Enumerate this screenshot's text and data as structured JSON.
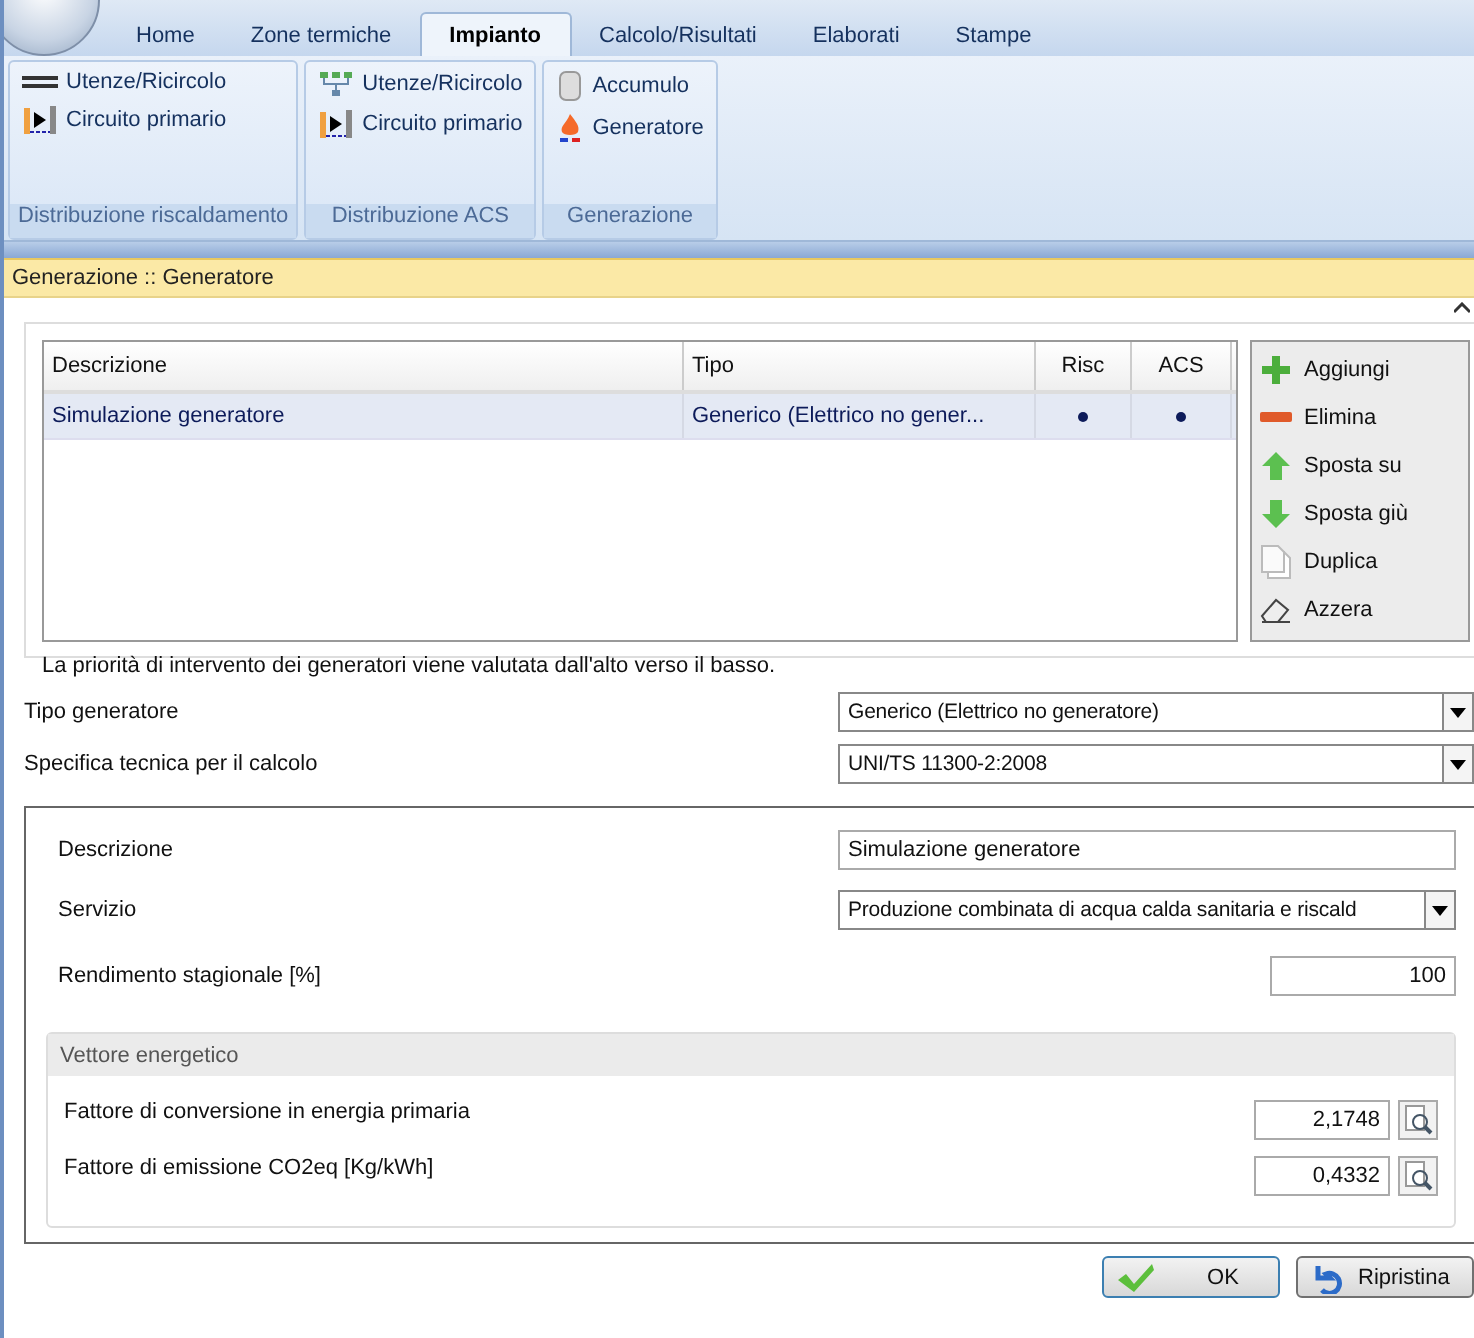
{
  "ribbon": {
    "tabs": [
      {
        "label": "Home",
        "selected": false
      },
      {
        "label": "Zone termiche",
        "selected": false
      },
      {
        "label": "Impianto",
        "selected": true
      },
      {
        "label": "Calcolo/Risultati",
        "selected": false
      },
      {
        "label": "Elaborati",
        "selected": false
      },
      {
        "label": "Stampe",
        "selected": false
      }
    ],
    "groups": [
      {
        "title": "Distribuzione riscaldamento",
        "items": [
          {
            "label": "Utenze/Ricircolo",
            "kind": "pipe"
          },
          {
            "label": "Circuito primario",
            "kind": "circuit"
          }
        ]
      },
      {
        "title": "Distribuzione ACS",
        "items": [
          {
            "label": "Utenze/Ricircolo",
            "kind": "network"
          },
          {
            "label": "Circuito primario",
            "kind": "circuit"
          }
        ]
      },
      {
        "title": "Generazione",
        "items": [
          {
            "label": "Accumulo",
            "kind": "tank"
          },
          {
            "label": "Generatore",
            "kind": "flame"
          }
        ]
      }
    ]
  },
  "panel_title": "Generazione :: Generatore",
  "table": {
    "columns": [
      "Descrizione",
      "Tipo",
      "Risc",
      "ACS"
    ],
    "rows": [
      {
        "cells": [
          "Simulazione generatore",
          "Generico (Elettrico no gener..."
        ],
        "risc": true,
        "acs": true,
        "selected": true
      }
    ]
  },
  "side_buttons": [
    {
      "label": "Aggiungi",
      "kind": "add"
    },
    {
      "label": "Elimina",
      "kind": "remove"
    },
    {
      "label": "Sposta su",
      "kind": "up"
    },
    {
      "label": "Sposta giù",
      "kind": "down"
    },
    {
      "label": "Duplica",
      "kind": "copy"
    },
    {
      "label": "Azzera",
      "kind": "erase"
    }
  ],
  "note": "La priorità di intervento dei generatori viene valutata dall'alto verso il basso.",
  "tipo_generatore": {
    "label": "Tipo generatore",
    "value": "Generico (Elettrico no generatore)"
  },
  "specifica": {
    "label": "Specifica tecnica per il calcolo",
    "value": "UNI/TS 11300-2:2008"
  },
  "descrizione": {
    "label": "Descrizione",
    "value": "Simulazione generatore"
  },
  "servizio": {
    "label": "Servizio",
    "value": "Produzione combinata di acqua calda sanitaria e riscald"
  },
  "rendimento": {
    "label": "Rendimento stagionale [%]",
    "value": "100"
  },
  "vettore": {
    "title": "Vettore energetico",
    "rows": [
      {
        "label": "Fattore di conversione in energia primaria",
        "value": "2,1748"
      },
      {
        "label": "Fattore di emissione CO2eq [Kg/kWh]",
        "value": "0,4332"
      }
    ]
  },
  "buttons": [
    {
      "label": "OK",
      "kind": "ok"
    },
    {
      "label": "Ripristina",
      "kind": "reset"
    }
  ]
}
